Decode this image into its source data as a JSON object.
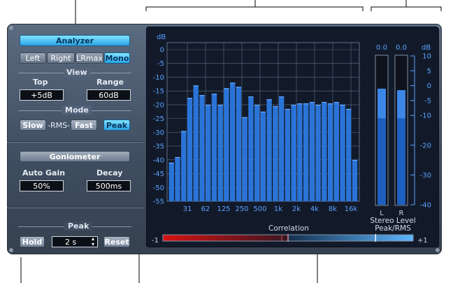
{
  "callouts": {
    "color": "#000000"
  },
  "left_panel": {
    "analyzer_label": "Analyzer",
    "channel_buttons": [
      "Left",
      "Right",
      "LRmax",
      "Mono"
    ],
    "view_header": "View",
    "top_label": "Top",
    "top_value": "+5dB",
    "range_label": "Range",
    "range_value": "60dB",
    "mode_header": "Mode",
    "slow_label": "Slow",
    "rms_label": "-RMS-",
    "fast_label": "Fast",
    "peak_button_label": "Peak",
    "goniometer_label": "Goniometer",
    "auto_gain_label": "Auto Gain",
    "auto_gain_value": "50%",
    "decay_label": "Decay",
    "decay_value": "500ms",
    "peak_header": "Peak",
    "hold_label": "Hold",
    "hold_time_value": "2 s",
    "reset_label": "Reset"
  },
  "spectrum": {
    "unit_label": "dB",
    "y_ticks": [
      "0",
      "-5",
      "-10",
      "-15",
      "-20",
      "-25",
      "-30",
      "-35",
      "-40",
      "-45",
      "-50",
      "-55"
    ],
    "x_ticks": [
      "31",
      "62",
      "125",
      "250",
      "500",
      "1k",
      "2k",
      "4k",
      "8k",
      "16k"
    ],
    "bar_levels_db": [
      -41,
      -39,
      -29.5,
      -17.5,
      -13,
      -16.5,
      -20,
      -16,
      -20,
      -14,
      -12,
      -13.5,
      -24.5,
      -17,
      -20,
      -22.5,
      -18,
      -20.5,
      -17,
      -21.5,
      -20,
      -19.5,
      -19.5,
      -19,
      -20,
      -19,
      -19.5,
      -19,
      -20,
      -21.5,
      -40
    ]
  },
  "level_meter": {
    "left_readout": "0.0",
    "right_readout": "0.0",
    "unit_label": "dB",
    "scale_ticks": [
      "10",
      "5",
      "0",
      "-5",
      "-10",
      "-20",
      "-30",
      "-40"
    ],
    "left_channel_label": "L",
    "right_channel_label": "R",
    "caption_line1": "Stereo Level",
    "caption_line2": "Peak/RMS",
    "left_peak_db": 0.0,
    "right_peak_db": 0.0,
    "left_fill_db": -1.0,
    "right_fill_db": -1.5,
    "left_rms_db": -11.0,
    "right_rms_db": -11.0
  },
  "correlation": {
    "label": "Correlation",
    "min_label": "-1",
    "max_label": "+1",
    "value": 0.0,
    "peak_marker": 0.7
  },
  "colors": {
    "bar": "#2a74d8",
    "bar_hi": "#69a8ff",
    "grid": "#5d6e84",
    "scale_text": "#5aa2ff",
    "readout": "#4bb1ff",
    "corr_negative": "#d81212",
    "corr_positive": "#5eb6ff"
  }
}
